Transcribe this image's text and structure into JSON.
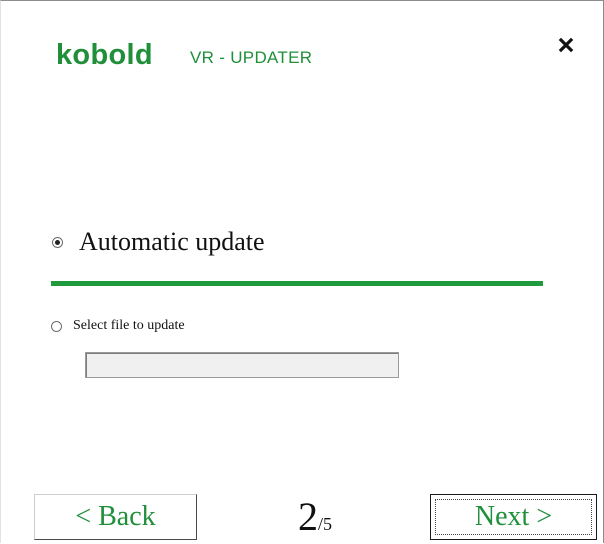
{
  "header": {
    "brand": "kobold",
    "subtitle": "VR - UPDATER",
    "close_icon": "close-icon"
  },
  "options": {
    "automatic": {
      "label": "Automatic update",
      "selected": true
    },
    "file": {
      "label": "Select file to update",
      "selected": false
    }
  },
  "file_input": {
    "value": "",
    "placeholder": ""
  },
  "footer": {
    "back_label": "< Back",
    "next_label": "Next >",
    "page_current": "2",
    "page_separator": "/",
    "page_total": "5"
  },
  "colors": {
    "accent": "#1f8f3a",
    "divider": "#1f9a3c"
  }
}
